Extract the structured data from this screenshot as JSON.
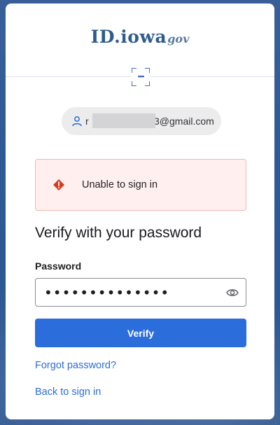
{
  "logo": {
    "text_id": "ID.iowa",
    "text_gov": "gov"
  },
  "factor": {
    "icon": "password-factor-icon",
    "dots": "••••"
  },
  "identifier": {
    "icon": "user-icon",
    "visible_prefix": "r",
    "visible_suffix": "3@gmail.com"
  },
  "alert": {
    "icon": "error-diamond-icon",
    "message": "Unable to sign in",
    "color": "#d93a1f"
  },
  "form": {
    "heading": "Verify with your password",
    "password_label": "Password",
    "password_value": "••••••••••••••",
    "show_password_icon": "eye-icon",
    "submit_label": "Verify"
  },
  "links": {
    "forgot": "Forgot password?",
    "back": "Back to sign in"
  },
  "colors": {
    "accent": "#2b6ddb",
    "brand": "#2f5c8f",
    "background": "#2f5a93"
  }
}
